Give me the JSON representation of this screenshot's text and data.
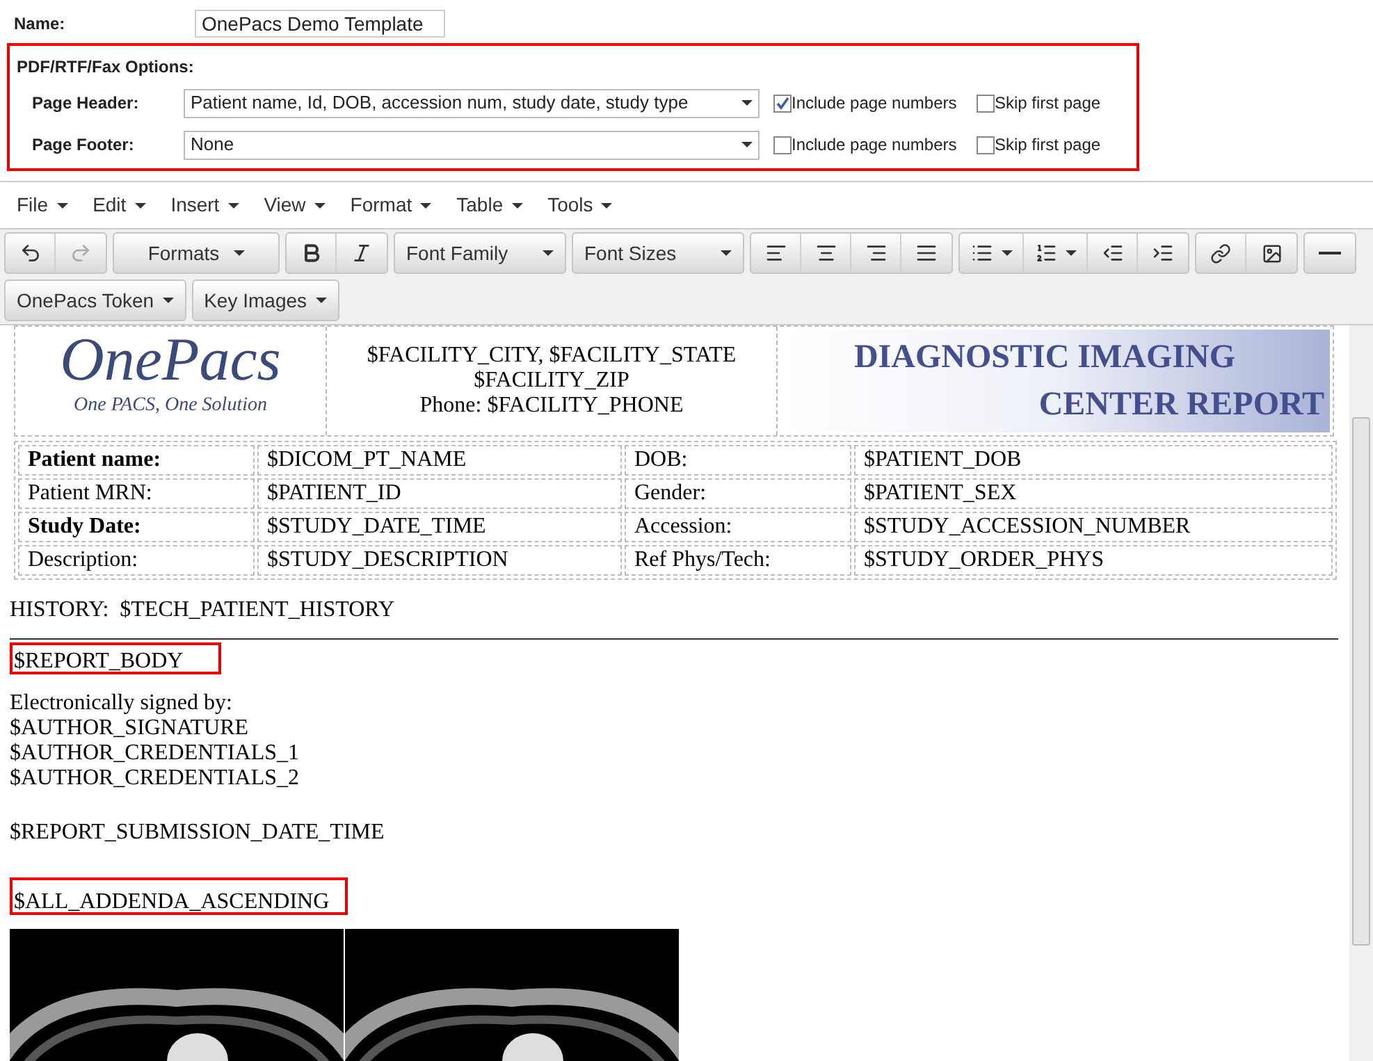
{
  "name": {
    "label": "Name:",
    "value": "OnePacs Demo Template"
  },
  "options": {
    "title": "PDF/RTF/Fax Options:",
    "highlighted": true,
    "rows": [
      {
        "label": "Page Header:",
        "value": "Patient name, Id, DOB, accession num, study date, study type",
        "include_page_numbers": {
          "label": "Include page numbers",
          "checked": true
        },
        "skip_first_page": {
          "label": "Skip first page",
          "checked": false
        }
      },
      {
        "label": "Page Footer:",
        "value": "None",
        "include_page_numbers": {
          "label": "Include page numbers",
          "checked": false
        },
        "skip_first_page": {
          "label": "Skip first page",
          "checked": false
        }
      }
    ]
  },
  "menu": [
    "File",
    "Edit",
    "Insert",
    "View",
    "Format",
    "Table",
    "Tools"
  ],
  "toolbar": {
    "undo": {
      "disabled": false
    },
    "redo": {
      "disabled": true
    },
    "formats": "Formats",
    "font_family": "Font Family",
    "font_sizes": "Font Sizes",
    "token": "OnePacs Token",
    "key_images": "Key Images"
  },
  "document": {
    "logo": {
      "title": "OnePacs",
      "tagline": "One PACS, One Solution"
    },
    "address": [
      "$FACILITY_CITY, $FACILITY_STATE",
      "$FACILITY_ZIP",
      "Phone: $FACILITY_PHONE"
    ],
    "banner": [
      "DIAGNOSTIC IMAGING",
      "CENTER REPORT"
    ],
    "table": [
      [
        {
          "text": "Patient name:",
          "bold": true
        },
        {
          "text": "$DICOM_PT_NAME",
          "bold": false
        },
        {
          "text": "DOB:",
          "bold": false
        },
        {
          "text": "$PATIENT_DOB",
          "bold": false
        }
      ],
      [
        {
          "text": "Patient MRN:",
          "bold": false
        },
        {
          "text": "$PATIENT_ID",
          "bold": false
        },
        {
          "text": "Gender:",
          "bold": false
        },
        {
          "text": "$PATIENT_SEX",
          "bold": false
        }
      ],
      [
        {
          "text": "Study Date:",
          "bold": true
        },
        {
          "text": "$STUDY_DATE_TIME",
          "bold": false
        },
        {
          "text": "Accession:",
          "bold": false
        },
        {
          "text": "$STUDY_ACCESSION_NUMBER",
          "bold": false
        }
      ],
      [
        {
          "text": "Description:",
          "bold": false
        },
        {
          "text": "$STUDY_DESCRIPTION",
          "bold": false
        },
        {
          "text": "Ref Phys/Tech:",
          "bold": false
        },
        {
          "text": "$STUDY_ORDER_PHYS",
          "bold": false
        }
      ]
    ],
    "history": "HISTORY:  $TECH_PATIENT_HISTORY",
    "report_body": {
      "text": "$REPORT_BODY",
      "highlighted": true
    },
    "signature": [
      "Electronically signed by:",
      "$AUTHOR_SIGNATURE",
      "$AUTHOR_CREDENTIALS_1",
      "$AUTHOR_CREDENTIALS_2"
    ],
    "submission": "$REPORT_SUBMISSION_DATE_TIME",
    "addenda": {
      "text": "$ALL_ADDENDA_ASCENDING",
      "highlighted": true
    }
  }
}
